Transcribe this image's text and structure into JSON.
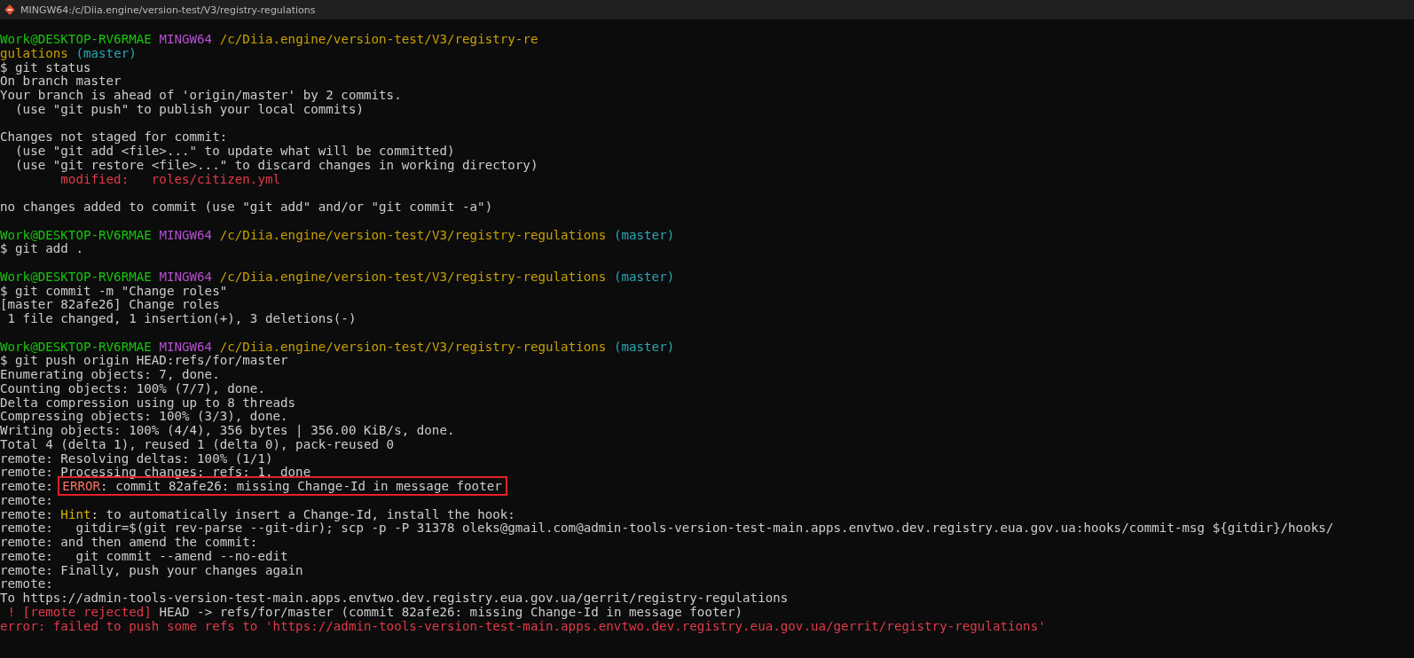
{
  "window": {
    "title": "MINGW64:/c/Diia.engine/version-test/V3/registry-regulations"
  },
  "terminal": {
    "lines": [
      {
        "kind": "text",
        "segments": [
          {
            "text": "Work@DESKTOP-RV6RMAE ",
            "kind": "user"
          },
          {
            "text": "MINGW64 ",
            "kind": "host"
          },
          {
            "text": "/c/Diia.engine/version-test/V3/registry-re",
            "kind": "path"
          }
        ]
      },
      {
        "kind": "text",
        "segments": [
          {
            "text": "gulations ",
            "kind": "path"
          },
          {
            "text": "(master)",
            "kind": "branch"
          }
        ]
      },
      {
        "kind": "text",
        "segments": [
          {
            "text": "$ git status",
            "kind": "plain"
          }
        ]
      },
      {
        "kind": "text",
        "segments": [
          {
            "text": "On branch master",
            "kind": "plain"
          }
        ]
      },
      {
        "kind": "text",
        "segments": [
          {
            "text": "Your branch is ahead of 'origin/master' by 2 commits.",
            "kind": "plain"
          }
        ]
      },
      {
        "kind": "text",
        "segments": [
          {
            "text": "  (use \"git push\" to publish your local commits)",
            "kind": "plain"
          }
        ]
      },
      {
        "kind": "blank"
      },
      {
        "kind": "text",
        "segments": [
          {
            "text": "Changes not staged for commit:",
            "kind": "plain"
          }
        ]
      },
      {
        "kind": "text",
        "segments": [
          {
            "text": "  (use \"git add <file>...\" to update what will be committed)",
            "kind": "plain"
          }
        ]
      },
      {
        "kind": "text",
        "segments": [
          {
            "text": "  (use \"git restore <file>...\" to discard changes in working directory)",
            "kind": "plain"
          }
        ]
      },
      {
        "kind": "text",
        "segments": [
          {
            "text": "        modified:   roles/citizen.yml",
            "kind": "red"
          }
        ]
      },
      {
        "kind": "blank"
      },
      {
        "kind": "text",
        "segments": [
          {
            "text": "no changes added to commit (use \"git add\" and/or \"git commit -a\")",
            "kind": "plain"
          }
        ]
      },
      {
        "kind": "blank"
      },
      {
        "kind": "text",
        "segments": [
          {
            "text": "Work@DESKTOP-RV6RMAE ",
            "kind": "user"
          },
          {
            "text": "MINGW64 ",
            "kind": "host"
          },
          {
            "text": "/c/Diia.engine/version-test/V3/registry-regulations ",
            "kind": "path"
          },
          {
            "text": "(master)",
            "kind": "branch"
          }
        ]
      },
      {
        "kind": "text",
        "segments": [
          {
            "text": "$ git add .",
            "kind": "plain"
          }
        ]
      },
      {
        "kind": "blank"
      },
      {
        "kind": "text",
        "segments": [
          {
            "text": "Work@DESKTOP-RV6RMAE ",
            "kind": "user"
          },
          {
            "text": "MINGW64 ",
            "kind": "host"
          },
          {
            "text": "/c/Diia.engine/version-test/V3/registry-regulations ",
            "kind": "path"
          },
          {
            "text": "(master)",
            "kind": "branch"
          }
        ]
      },
      {
        "kind": "text",
        "segments": [
          {
            "text": "$ git commit -m \"Change roles\"",
            "kind": "plain"
          }
        ]
      },
      {
        "kind": "text",
        "segments": [
          {
            "text": "[master 82afe26] Change roles",
            "kind": "plain"
          }
        ]
      },
      {
        "kind": "text",
        "segments": [
          {
            "text": " 1 file changed, 1 insertion(+), 3 deletions(-)",
            "kind": "plain"
          }
        ]
      },
      {
        "kind": "blank"
      },
      {
        "kind": "text",
        "segments": [
          {
            "text": "Work@DESKTOP-RV6RMAE ",
            "kind": "user"
          },
          {
            "text": "MINGW64 ",
            "kind": "host"
          },
          {
            "text": "/c/Diia.engine/version-test/V3/registry-regulations ",
            "kind": "path"
          },
          {
            "text": "(master)",
            "kind": "branch"
          }
        ]
      },
      {
        "kind": "text",
        "segments": [
          {
            "text": "$ git push origin HEAD:refs/for/master",
            "kind": "plain"
          }
        ]
      },
      {
        "kind": "text",
        "segments": [
          {
            "text": "Enumerating objects: 7, done.",
            "kind": "plain"
          }
        ]
      },
      {
        "kind": "text",
        "segments": [
          {
            "text": "Counting objects: 100% (7/7), done.",
            "kind": "plain"
          }
        ]
      },
      {
        "kind": "text",
        "segments": [
          {
            "text": "Delta compression using up to 8 threads",
            "kind": "plain"
          }
        ]
      },
      {
        "kind": "text",
        "segments": [
          {
            "text": "Compressing objects: 100% (3/3), done.",
            "kind": "plain"
          }
        ]
      },
      {
        "kind": "text",
        "segments": [
          {
            "text": "Writing objects: 100% (4/4), 356 bytes | 356.00 KiB/s, done.",
            "kind": "plain"
          }
        ]
      },
      {
        "kind": "text",
        "segments": [
          {
            "text": "Total 4 (delta 1), reused 1 (delta 0), pack-reused 0",
            "kind": "plain"
          }
        ]
      },
      {
        "kind": "text",
        "segments": [
          {
            "text": "remote: Resolving deltas: 100% (1/1)",
            "kind": "plain"
          }
        ]
      },
      {
        "kind": "text",
        "segments": [
          {
            "text": "remote: Processing changes: refs: 1, done",
            "kind": "plain"
          }
        ]
      },
      {
        "kind": "text",
        "segments": [
          {
            "text": "remote: ",
            "kind": "plain"
          },
          {
            "text": "ERROR",
            "kind": "error",
            "boxed": true
          },
          {
            "text": ": commit 82afe26: missing Change-Id in message footer",
            "kind": "plain",
            "boxed": true
          }
        ]
      },
      {
        "kind": "text",
        "segments": [
          {
            "text": "remote:",
            "kind": "plain"
          }
        ]
      },
      {
        "kind": "text",
        "segments": [
          {
            "text": "remote: ",
            "kind": "plain"
          },
          {
            "text": "Hint",
            "kind": "hint"
          },
          {
            "text": ": to automatically insert a Change-Id, install the hook:",
            "kind": "plain"
          }
        ]
      },
      {
        "kind": "text",
        "segments": [
          {
            "text": "remote:   gitdir=$(git rev-parse --git-dir); scp -p -P 31378 oleks@gmail.com@admin-tools-version-test-main.apps.envtwo.dev.registry.eua.gov.ua:hooks/commit-msg ${gitdir}/hooks/",
            "kind": "plain"
          }
        ]
      },
      {
        "kind": "text",
        "segments": [
          {
            "text": "remote: and then amend the commit:",
            "kind": "plain"
          }
        ]
      },
      {
        "kind": "text",
        "segments": [
          {
            "text": "remote:   git commit --amend --no-edit",
            "kind": "plain"
          }
        ]
      },
      {
        "kind": "text",
        "segments": [
          {
            "text": "remote: Finally, push your changes again",
            "kind": "plain"
          }
        ]
      },
      {
        "kind": "text",
        "segments": [
          {
            "text": "remote:",
            "kind": "plain"
          }
        ]
      },
      {
        "kind": "text",
        "segments": [
          {
            "text": "To https://admin-tools-version-test-main.apps.envtwo.dev.registry.eua.gov.ua/gerrit/registry-regulations",
            "kind": "plain"
          }
        ]
      },
      {
        "kind": "text",
        "segments": [
          {
            "text": " ! [remote rejected]",
            "kind": "red"
          },
          {
            "text": " HEAD -> refs/for/master (commit 82afe26: missing Change-Id in message footer)",
            "kind": "plain"
          }
        ]
      },
      {
        "kind": "text",
        "segments": [
          {
            "text": "error: failed to push some refs to 'https://admin-tools-version-test-main.apps.envtwo.dev.registry.eua.gov.ua/gerrit/registry-regulations'",
            "kind": "red"
          }
        ]
      }
    ]
  }
}
